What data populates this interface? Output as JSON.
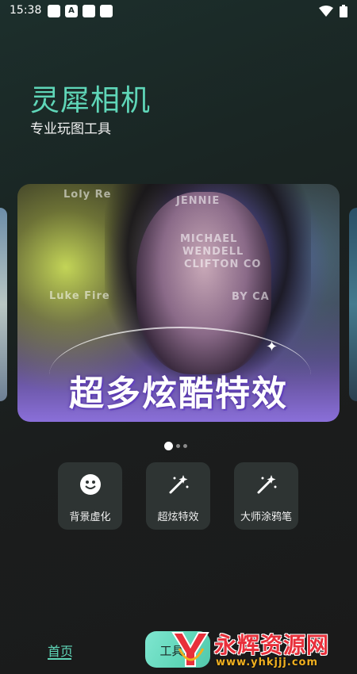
{
  "status_bar": {
    "time": "15:38",
    "left_icons": [
      "notification-icon",
      "font-icon",
      "notification-icon",
      "notification-icon"
    ],
    "alpha_glyph": "A",
    "right_icons": [
      "wifi-icon",
      "battery-icon"
    ]
  },
  "header": {
    "title": "灵犀相机",
    "subtitle": "专业玩图工具"
  },
  "banner": {
    "caption": "超多炫酷特效",
    "overlay_text": [
      "MICHAEL",
      "WENDELL",
      "CLIFTON CO",
      "JENNIE",
      "BY CA",
      "Loly Re",
      "Luke Fire"
    ]
  },
  "pagination": {
    "total": 3,
    "active_index": 0
  },
  "features": [
    {
      "label": "背景虚化",
      "icon": "smiley-face-icon"
    },
    {
      "label": "超炫特效",
      "icon": "magic-wand-icon"
    },
    {
      "label": "大师涂鸦笔",
      "icon": "magic-wand-icon"
    }
  ],
  "bottom_nav": {
    "home_label": "首页",
    "tools_label": "工具箱"
  },
  "watermark": {
    "title": "永辉资源网",
    "url": "www.yhkjjj.com"
  },
  "colors": {
    "accent": "#5fd6b8",
    "tile_bg": "#2e3433",
    "watermark_red": "#e8303b"
  }
}
